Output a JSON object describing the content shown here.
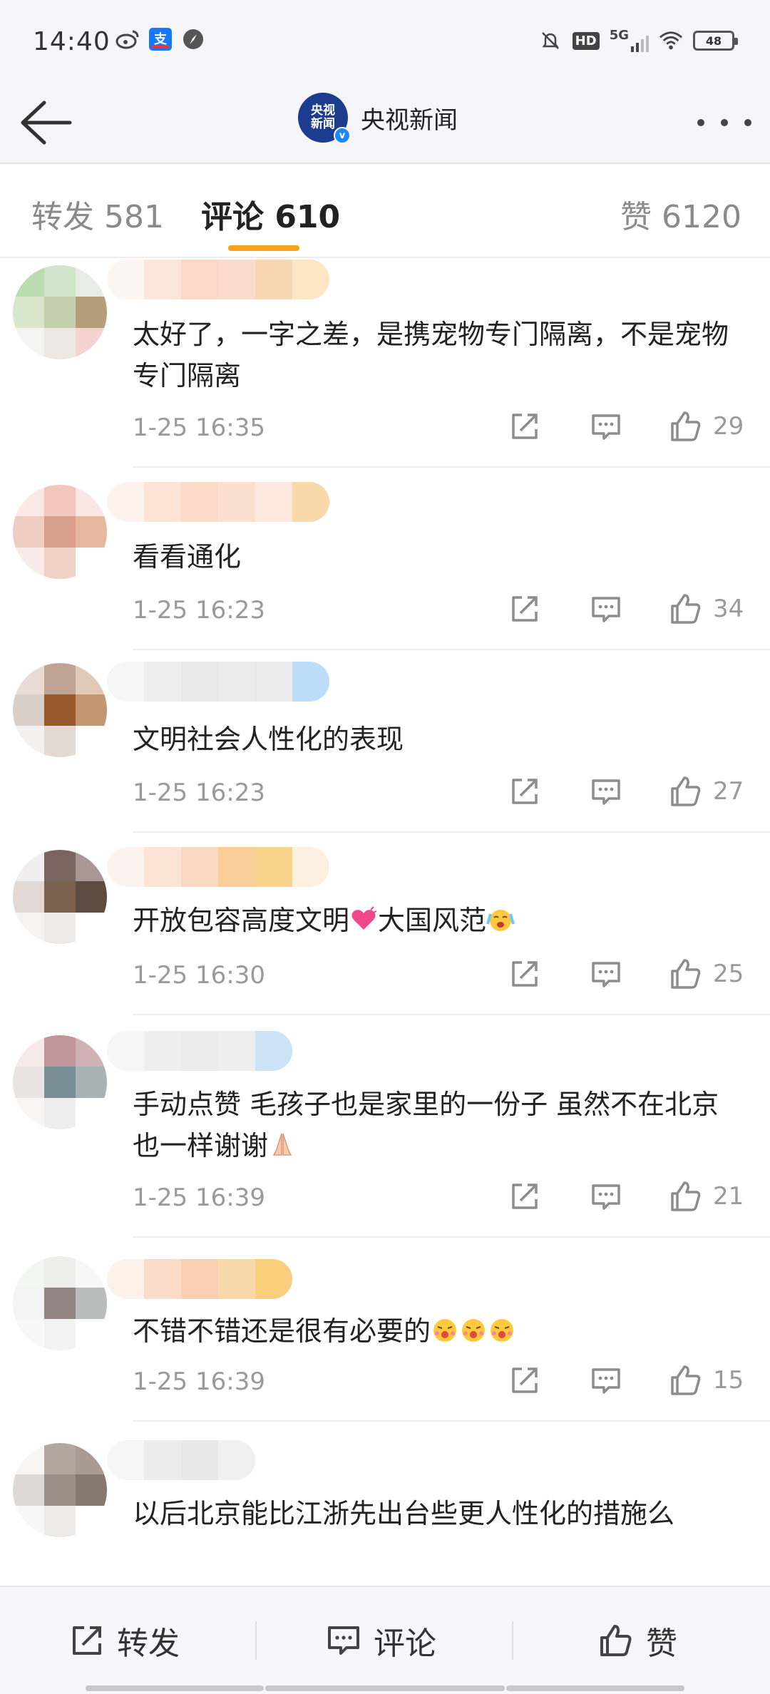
{
  "status_bar": {
    "time": "14:40",
    "battery": "48",
    "network": "5G",
    "hd": "HD",
    "icons": [
      "weibo-icon",
      "alipay-icon",
      "compass-icon",
      "mute-bell-icon",
      "hd-icon",
      "signal-icon",
      "wifi-icon",
      "battery-icon"
    ]
  },
  "nav": {
    "title": "央视新闻",
    "avatar_line1": "央视",
    "avatar_line2": "新闻",
    "verified_mark": "v"
  },
  "tabs": {
    "repost": "转发 581",
    "comment": "评论 610",
    "like": "赞 6120",
    "accent_color": "#f7a21b"
  },
  "comments": [
    {
      "text": "太好了，一字之差，是携宠物专门隔离，不是宠物专门隔离",
      "time": "1-25 16:35",
      "likes": "29"
    },
    {
      "text": "看看通化",
      "time": "1-25 16:23",
      "likes": "34"
    },
    {
      "text": "文明社会人性化的表现",
      "time": "1-25 16:23",
      "likes": "27"
    },
    {
      "text": "开放包容高度文明",
      "text2": "大国风范",
      "time": "1-25 16:30",
      "likes": "25"
    },
    {
      "text": "手动点赞 毛孩子也是家里的一份子 虽然不在北京 也一样谢谢",
      "time": "1-25 16:39",
      "likes": "21"
    },
    {
      "text": "不错不错还是很有必要的",
      "time": "1-25 16:39",
      "likes": "15"
    },
    {
      "text": "以后北京能比江浙先出台些更人性化的措施么"
    }
  ],
  "bottom_bar": {
    "repost": "转发",
    "comment": "评论",
    "like": "赞"
  }
}
